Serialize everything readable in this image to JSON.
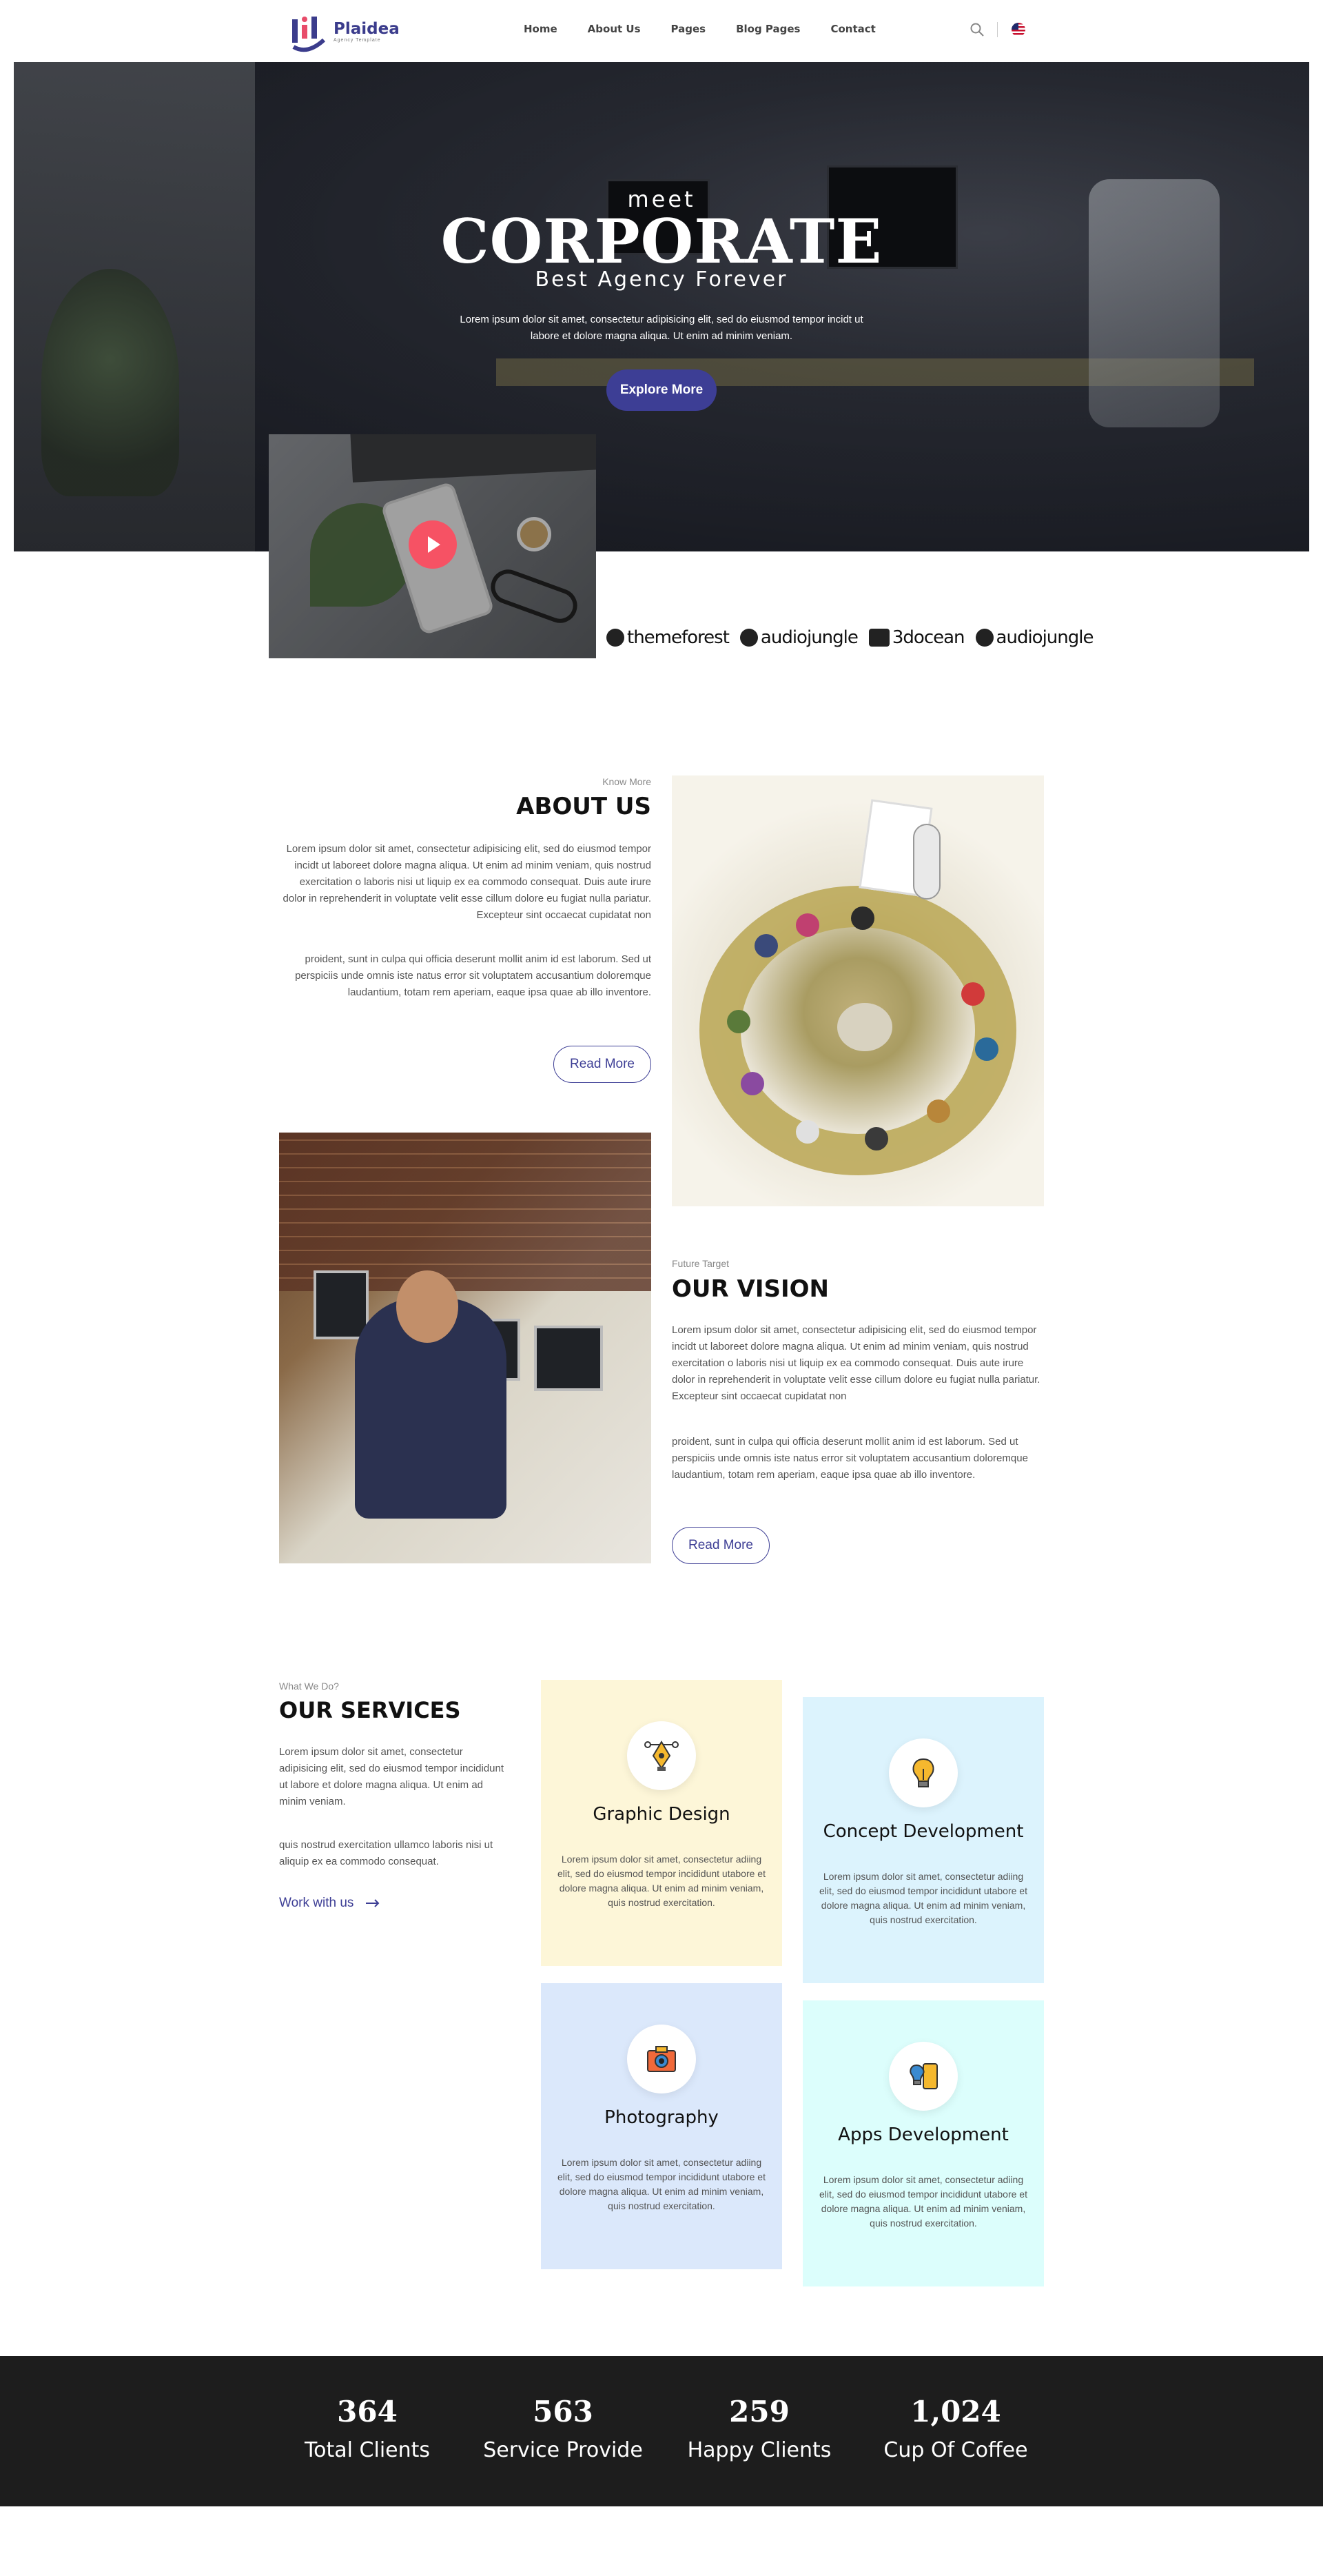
{
  "brand": {
    "name": "Plaidea",
    "tagline": "Agency Template",
    "accent": "#3d3e95"
  },
  "nav": {
    "items": [
      "Home",
      "About Us",
      "Pages",
      "Blog Pages",
      "Contact"
    ],
    "search_icon": "search-icon",
    "language_icon": "us-flag-icon"
  },
  "hero": {
    "meet": "meet",
    "title": "CORPORATE",
    "subtitle": "Best Agency Forever",
    "description": "Lorem ipsum dolor sit amet, consectetur adipisicing elit, sed do eiusmod tempor incidt ut labore et dolore magna aliqua. Ut enim ad minim veniam.",
    "button": "Explore More"
  },
  "video": {
    "play_icon": "play-icon"
  },
  "partners": [
    "themeforest",
    "audiojungle",
    "3docean",
    "audiojungle"
  ],
  "about": {
    "eyebrow": "Know More",
    "title": "ABOUT US",
    "paragraph1": "Lorem ipsum dolor sit amet, consectetur adipisicing elit, sed do eiusmod tempor incidt ut laboreet dolore magna aliqua. Ut enim ad minim veniam, quis nostrud exercitation o laboris nisi ut liquip ex ea commodo consequat. Duis aute irure dolor in reprehenderit in voluptate velit esse cillum dolore eu fugiat nulla pariatur. Excepteur sint occaecat cupidatat non",
    "paragraph2": "proident, sunt in culpa qui officia deserunt mollit anim id est laborum. Sed ut perspiciis unde omnis iste natus error sit voluptatem accusantium doloremque laudantium, totam rem aperiam, eaque ipsa quae ab illo inventore.",
    "button": "Read More"
  },
  "vision": {
    "eyebrow": "Future Target",
    "title": "OUR VISION",
    "paragraph1": "Lorem ipsum dolor sit amet, consectetur adipisicing elit, sed do eiusmod tempor incidt ut laboreet dolore magna aliqua. Ut enim ad minim veniam, quis nostrud exercitation o laboris nisi ut liquip ex ea commodo consequat. Duis aute irure dolor in reprehenderit in voluptate velit esse cillum dolore eu fugiat nulla pariatur. Excepteur sint occaecat cupidatat non",
    "paragraph2": "proident, sunt in culpa qui officia deserunt mollit anim id est laborum. Sed ut perspiciis unde omnis iste natus error sit voluptatem accusantium doloremque laudantium, totam rem aperiam, eaque ipsa quae ab illo inventore.",
    "button": "Read More"
  },
  "services": {
    "eyebrow": "What We Do?",
    "title": "OUR SERVICES",
    "paragraph1": "Lorem ipsum dolor sit amet, consectetur adipisicing elit, sed do eiusmod tempor incididunt ut labore et dolore magna aliqua. Ut enim ad minim veniam.",
    "paragraph2": "quis nostrud exercitation ullamco laboris nisi ut aliquip ex ea commodo consequat.",
    "link": "Work with us",
    "cards": [
      {
        "title": "Graphic Design",
        "icon": "pen-tool-icon",
        "color": "#fdf6d8",
        "desc": "Lorem ipsum dolor sit amet, consectetur adiing elit, sed do eiusmod tempor incididunt utabore et dolore magna aliqua. Ut enim ad minim veniam, quis nostrud exercitation."
      },
      {
        "title": "Concept Development",
        "icon": "lightbulb-icon",
        "color": "#dcf3fd",
        "desc": "Lorem ipsum dolor sit amet, consectetur adiing elit, sed do eiusmod tempor incididunt utabore et dolore magna aliqua. Ut enim ad minim veniam, quis nostrud exercitation."
      },
      {
        "title": "Photography",
        "icon": "camera-icon",
        "color": "#dbe8fb",
        "desc": "Lorem ipsum dolor sit amet, consectetur adiing elit, sed do eiusmod tempor incididunt utabore et dolore magna aliqua. Ut enim ad minim veniam, quis nostrud exercitation."
      },
      {
        "title": "Apps Development",
        "icon": "app-bulb-icon",
        "color": "#dcfefc",
        "desc": "Lorem ipsum dolor sit amet, consectetur adiing elit, sed do eiusmod tempor incididunt utabore et dolore magna aliqua. Ut enim ad minim veniam, quis nostrud exercitation."
      }
    ]
  },
  "stats": [
    {
      "number": "364",
      "label": "Total Clients"
    },
    {
      "number": "563",
      "label": "Service Provide"
    },
    {
      "number": "259",
      "label": "Happy Clients"
    },
    {
      "number": "1,024",
      "label": "Cup Of Coffee"
    }
  ]
}
